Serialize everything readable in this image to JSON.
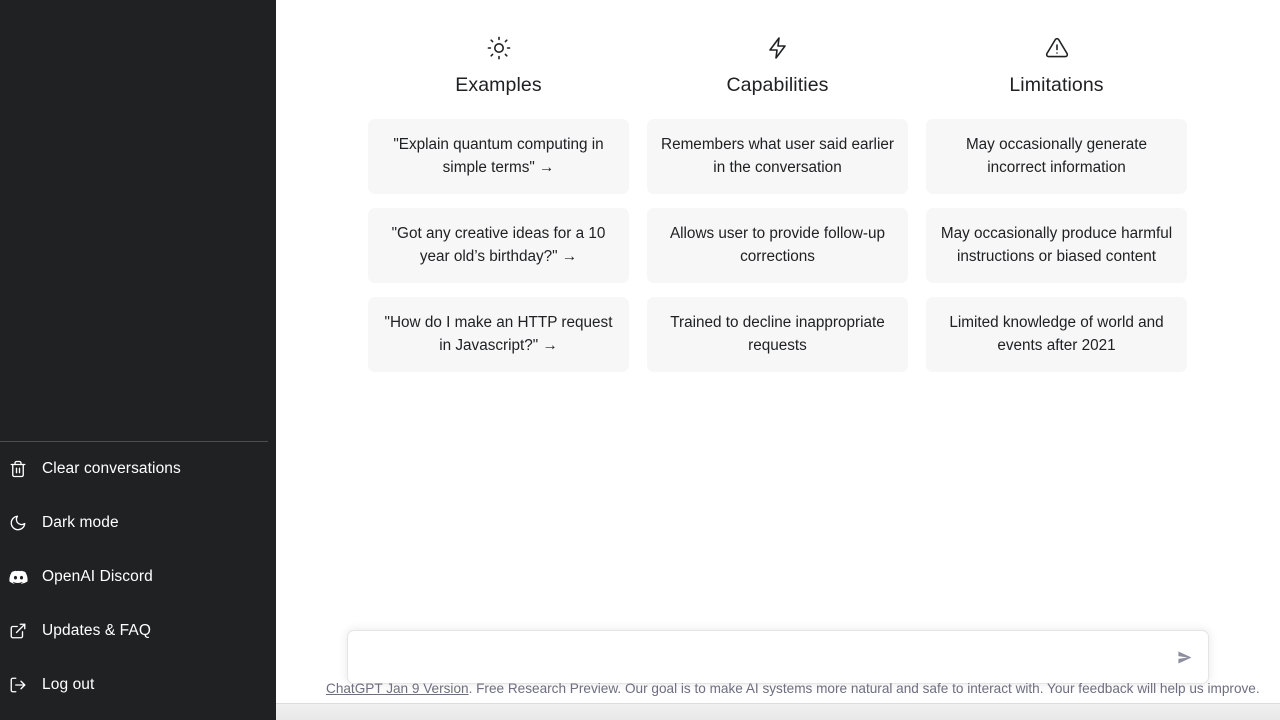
{
  "sidebar": {
    "background_color": "#202123",
    "nav_items": [
      {
        "icon": "trash-icon",
        "label": "Clear conversations"
      },
      {
        "icon": "moon-icon",
        "label": "Dark mode"
      },
      {
        "icon": "discord-icon",
        "label": "OpenAI Discord"
      },
      {
        "icon": "external-link-icon",
        "label": "Updates & FAQ"
      },
      {
        "icon": "logout-icon",
        "label": "Log out"
      }
    ]
  },
  "main": {
    "columns": [
      {
        "icon": "sun-icon",
        "title": "Examples",
        "clickable_cards": true,
        "cards": [
          "\"Explain quantum computing in simple terms\" →",
          "\"Got any creative ideas for a 10 year old’s birthday?\" →",
          "\"How do I make an HTTP request in Javascript?\" →"
        ]
      },
      {
        "icon": "lightning-icon",
        "title": "Capabilities",
        "clickable_cards": false,
        "cards": [
          "Remembers what user said earlier in the conversation",
          "Allows user to provide follow-up corrections",
          "Trained to decline inappropriate requests"
        ]
      },
      {
        "icon": "warning-triangle-icon",
        "title": "Limitations",
        "clickable_cards": false,
        "cards": [
          "May occasionally generate incorrect information",
          "May occasionally produce harmful instructions or biased content",
          "Limited knowledge of world and events after 2021"
        ]
      }
    ]
  },
  "composer": {
    "value": "",
    "placeholder": "",
    "send_icon": "send-arrow-icon"
  },
  "footer": {
    "link_text": "ChatGPT Jan 9 Version",
    "rest_text": ". Free Research Preview. Our goal is to make AI systems more natural and safe to interact with. Your feedback will help us improve."
  },
  "colors": {
    "sidebar_bg": "#202123",
    "card_bg": "#f7f7f8",
    "text_primary": "#202123",
    "text_muted": "#6e6e80"
  }
}
